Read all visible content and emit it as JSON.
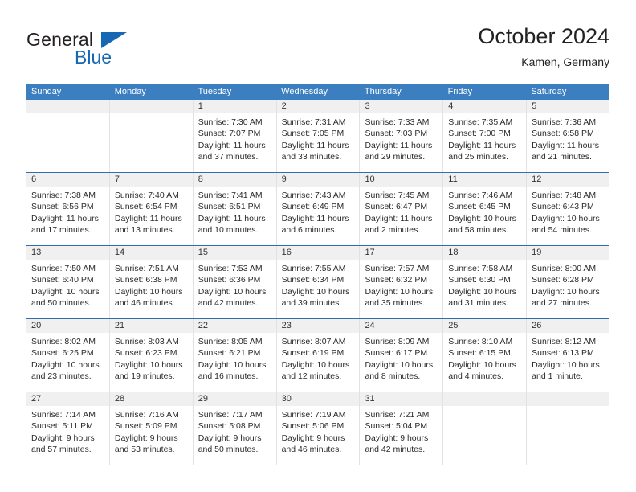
{
  "logo": {
    "line1": "General",
    "line2": "Blue",
    "accent_color": "#1668b3"
  },
  "header": {
    "title": "October 2024",
    "subtitle": "Kamen, Germany"
  },
  "calendar": {
    "header_color": "#3c7fc1",
    "separator_color": "#2f6fad",
    "date_band_color": "#f0f0f0",
    "weekdays": [
      "Sunday",
      "Monday",
      "Tuesday",
      "Wednesday",
      "Thursday",
      "Friday",
      "Saturday"
    ],
    "weeks": [
      [
        {
          "date": "",
          "empty": true,
          "sunrise": "",
          "sunset": "",
          "daylight1": "",
          "daylight2": ""
        },
        {
          "date": "",
          "empty": true,
          "sunrise": "",
          "sunset": "",
          "daylight1": "",
          "daylight2": ""
        },
        {
          "date": "1",
          "sunrise": "Sunrise: 7:30 AM",
          "sunset": "Sunset: 7:07 PM",
          "daylight1": "Daylight: 11 hours",
          "daylight2": "and 37 minutes."
        },
        {
          "date": "2",
          "sunrise": "Sunrise: 7:31 AM",
          "sunset": "Sunset: 7:05 PM",
          "daylight1": "Daylight: 11 hours",
          "daylight2": "and 33 minutes."
        },
        {
          "date": "3",
          "sunrise": "Sunrise: 7:33 AM",
          "sunset": "Sunset: 7:03 PM",
          "daylight1": "Daylight: 11 hours",
          "daylight2": "and 29 minutes."
        },
        {
          "date": "4",
          "sunrise": "Sunrise: 7:35 AM",
          "sunset": "Sunset: 7:00 PM",
          "daylight1": "Daylight: 11 hours",
          "daylight2": "and 25 minutes."
        },
        {
          "date": "5",
          "sunrise": "Sunrise: 7:36 AM",
          "sunset": "Sunset: 6:58 PM",
          "daylight1": "Daylight: 11 hours",
          "daylight2": "and 21 minutes."
        }
      ],
      [
        {
          "date": "6",
          "sunrise": "Sunrise: 7:38 AM",
          "sunset": "Sunset: 6:56 PM",
          "daylight1": "Daylight: 11 hours",
          "daylight2": "and 17 minutes."
        },
        {
          "date": "7",
          "sunrise": "Sunrise: 7:40 AM",
          "sunset": "Sunset: 6:54 PM",
          "daylight1": "Daylight: 11 hours",
          "daylight2": "and 13 minutes."
        },
        {
          "date": "8",
          "sunrise": "Sunrise: 7:41 AM",
          "sunset": "Sunset: 6:51 PM",
          "daylight1": "Daylight: 11 hours",
          "daylight2": "and 10 minutes."
        },
        {
          "date": "9",
          "sunrise": "Sunrise: 7:43 AM",
          "sunset": "Sunset: 6:49 PM",
          "daylight1": "Daylight: 11 hours",
          "daylight2": "and 6 minutes."
        },
        {
          "date": "10",
          "sunrise": "Sunrise: 7:45 AM",
          "sunset": "Sunset: 6:47 PM",
          "daylight1": "Daylight: 11 hours",
          "daylight2": "and 2 minutes."
        },
        {
          "date": "11",
          "sunrise": "Sunrise: 7:46 AM",
          "sunset": "Sunset: 6:45 PM",
          "daylight1": "Daylight: 10 hours",
          "daylight2": "and 58 minutes."
        },
        {
          "date": "12",
          "sunrise": "Sunrise: 7:48 AM",
          "sunset": "Sunset: 6:43 PM",
          "daylight1": "Daylight: 10 hours",
          "daylight2": "and 54 minutes."
        }
      ],
      [
        {
          "date": "13",
          "sunrise": "Sunrise: 7:50 AM",
          "sunset": "Sunset: 6:40 PM",
          "daylight1": "Daylight: 10 hours",
          "daylight2": "and 50 minutes."
        },
        {
          "date": "14",
          "sunrise": "Sunrise: 7:51 AM",
          "sunset": "Sunset: 6:38 PM",
          "daylight1": "Daylight: 10 hours",
          "daylight2": "and 46 minutes."
        },
        {
          "date": "15",
          "sunrise": "Sunrise: 7:53 AM",
          "sunset": "Sunset: 6:36 PM",
          "daylight1": "Daylight: 10 hours",
          "daylight2": "and 42 minutes."
        },
        {
          "date": "16",
          "sunrise": "Sunrise: 7:55 AM",
          "sunset": "Sunset: 6:34 PM",
          "daylight1": "Daylight: 10 hours",
          "daylight2": "and 39 minutes."
        },
        {
          "date": "17",
          "sunrise": "Sunrise: 7:57 AM",
          "sunset": "Sunset: 6:32 PM",
          "daylight1": "Daylight: 10 hours",
          "daylight2": "and 35 minutes."
        },
        {
          "date": "18",
          "sunrise": "Sunrise: 7:58 AM",
          "sunset": "Sunset: 6:30 PM",
          "daylight1": "Daylight: 10 hours",
          "daylight2": "and 31 minutes."
        },
        {
          "date": "19",
          "sunrise": "Sunrise: 8:00 AM",
          "sunset": "Sunset: 6:28 PM",
          "daylight1": "Daylight: 10 hours",
          "daylight2": "and 27 minutes."
        }
      ],
      [
        {
          "date": "20",
          "sunrise": "Sunrise: 8:02 AM",
          "sunset": "Sunset: 6:25 PM",
          "daylight1": "Daylight: 10 hours",
          "daylight2": "and 23 minutes."
        },
        {
          "date": "21",
          "sunrise": "Sunrise: 8:03 AM",
          "sunset": "Sunset: 6:23 PM",
          "daylight1": "Daylight: 10 hours",
          "daylight2": "and 19 minutes."
        },
        {
          "date": "22",
          "sunrise": "Sunrise: 8:05 AM",
          "sunset": "Sunset: 6:21 PM",
          "daylight1": "Daylight: 10 hours",
          "daylight2": "and 16 minutes."
        },
        {
          "date": "23",
          "sunrise": "Sunrise: 8:07 AM",
          "sunset": "Sunset: 6:19 PM",
          "daylight1": "Daylight: 10 hours",
          "daylight2": "and 12 minutes."
        },
        {
          "date": "24",
          "sunrise": "Sunrise: 8:09 AM",
          "sunset": "Sunset: 6:17 PM",
          "daylight1": "Daylight: 10 hours",
          "daylight2": "and 8 minutes."
        },
        {
          "date": "25",
          "sunrise": "Sunrise: 8:10 AM",
          "sunset": "Sunset: 6:15 PM",
          "daylight1": "Daylight: 10 hours",
          "daylight2": "and 4 minutes."
        },
        {
          "date": "26",
          "sunrise": "Sunrise: 8:12 AM",
          "sunset": "Sunset: 6:13 PM",
          "daylight1": "Daylight: 10 hours",
          "daylight2": "and 1 minute."
        }
      ],
      [
        {
          "date": "27",
          "sunrise": "Sunrise: 7:14 AM",
          "sunset": "Sunset: 5:11 PM",
          "daylight1": "Daylight: 9 hours",
          "daylight2": "and 57 minutes."
        },
        {
          "date": "28",
          "sunrise": "Sunrise: 7:16 AM",
          "sunset": "Sunset: 5:09 PM",
          "daylight1": "Daylight: 9 hours",
          "daylight2": "and 53 minutes."
        },
        {
          "date": "29",
          "sunrise": "Sunrise: 7:17 AM",
          "sunset": "Sunset: 5:08 PM",
          "daylight1": "Daylight: 9 hours",
          "daylight2": "and 50 minutes."
        },
        {
          "date": "30",
          "sunrise": "Sunrise: 7:19 AM",
          "sunset": "Sunset: 5:06 PM",
          "daylight1": "Daylight: 9 hours",
          "daylight2": "and 46 minutes."
        },
        {
          "date": "31",
          "sunrise": "Sunrise: 7:21 AM",
          "sunset": "Sunset: 5:04 PM",
          "daylight1": "Daylight: 9 hours",
          "daylight2": "and 42 minutes."
        },
        {
          "date": "",
          "empty": true,
          "sunrise": "",
          "sunset": "",
          "daylight1": "",
          "daylight2": ""
        },
        {
          "date": "",
          "empty": true,
          "sunrise": "",
          "sunset": "",
          "daylight1": "",
          "daylight2": ""
        }
      ]
    ]
  }
}
